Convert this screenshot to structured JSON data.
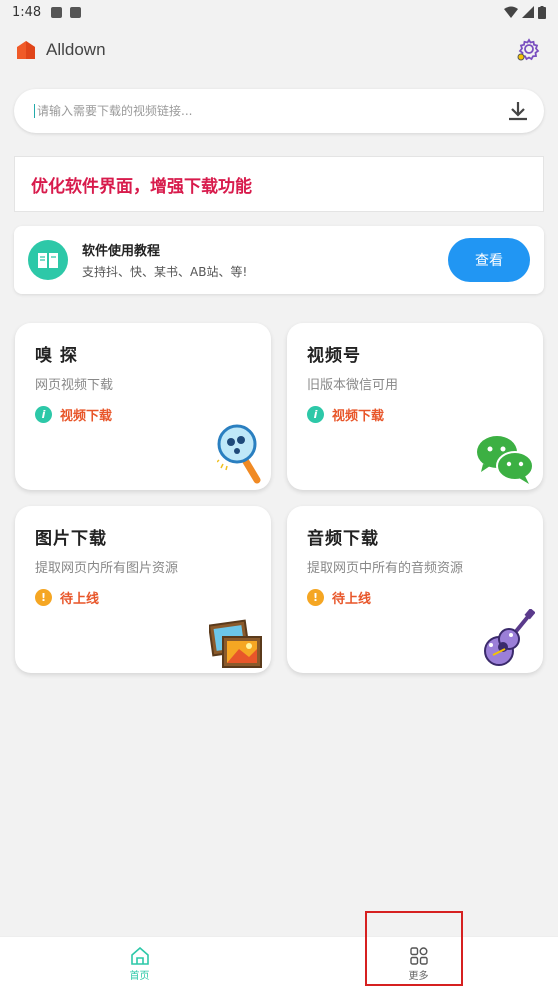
{
  "status_bar": {
    "time": "1:48"
  },
  "header": {
    "app_title": "Alldown"
  },
  "search": {
    "placeholder": "请输入需要下载的视频链接..."
  },
  "banner": {
    "text": "优化软件界面，增强下载功能"
  },
  "tutorial": {
    "title": "软件使用教程",
    "subtitle": "支持抖、快、某书、AB站、等!",
    "button_label": "查看"
  },
  "cards": [
    {
      "title": "嗅 探",
      "subtitle": "网页视频下载",
      "status": "视频下载",
      "status_icon": "info-icon"
    },
    {
      "title": "视频号",
      "subtitle": "旧版本微信可用",
      "status": "视频下载",
      "status_icon": "info-icon"
    },
    {
      "title": "图片下载",
      "subtitle": "提取网页内所有图片资源",
      "status": "待上线",
      "status_icon": "warning-icon"
    },
    {
      "title": "音频下载",
      "subtitle": "提取网页中所有的音频资源",
      "status": "待上线",
      "status_icon": "warning-icon"
    }
  ],
  "bottom_nav": {
    "items": [
      {
        "label": "首页",
        "icon": "home-icon",
        "active": true
      },
      {
        "label": "更多",
        "icon": "grid-icon",
        "active": false
      }
    ]
  },
  "colors": {
    "accent": "#2dc8a8",
    "banner_text": "#d81b4c",
    "status_text": "#e8562a",
    "button_blue": "#2196f3",
    "highlight": "#d62020"
  }
}
